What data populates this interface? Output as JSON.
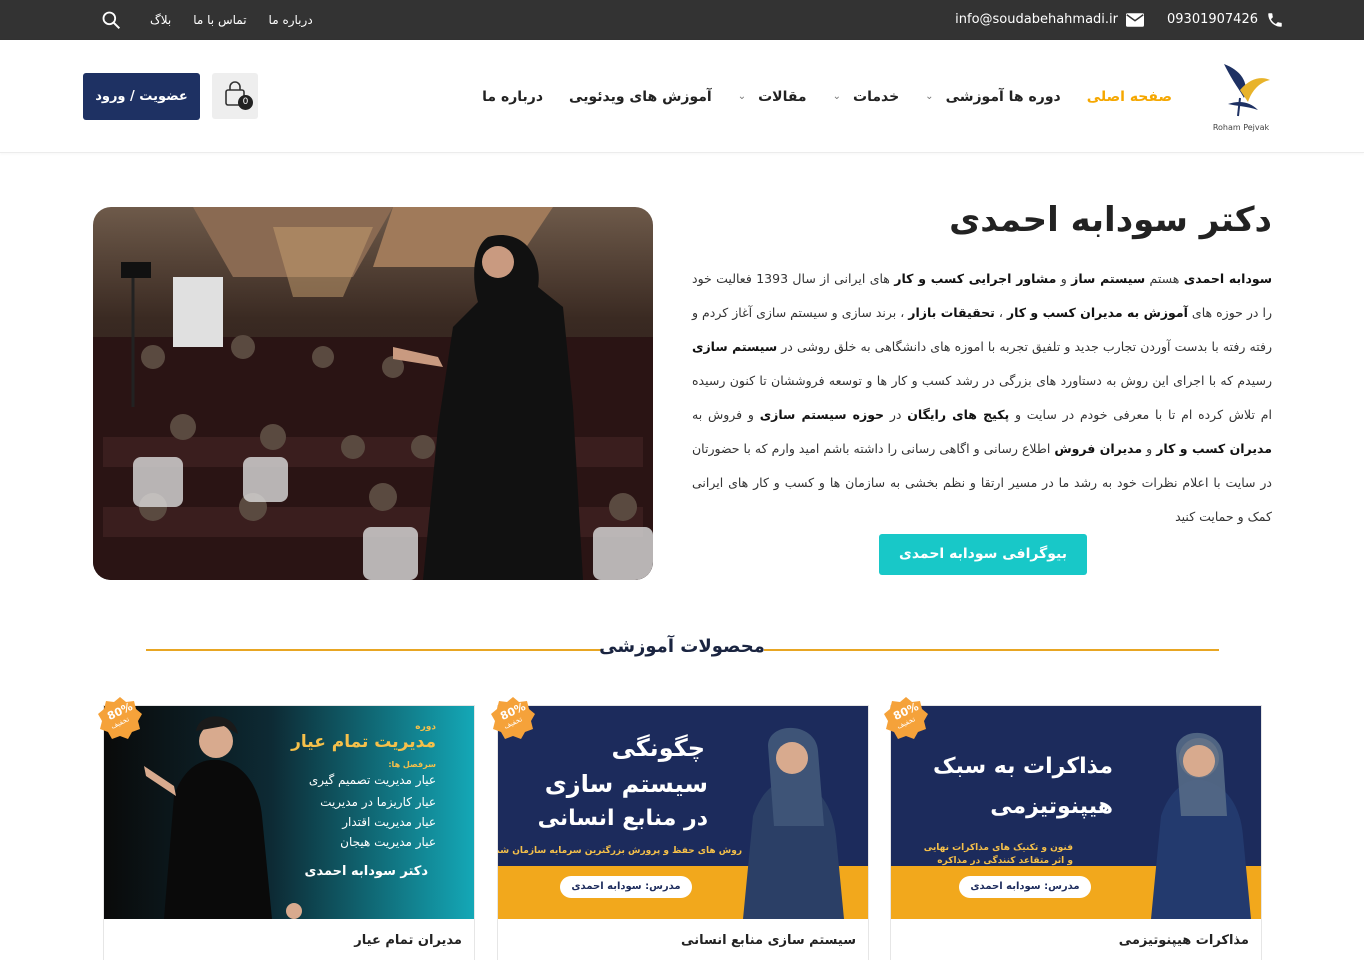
{
  "topbar": {
    "phone": "09301907426",
    "email": "info@soudabehahmadi.ir",
    "links": [
      "بلاگ",
      "تماس با ما",
      "درباره ما"
    ]
  },
  "header": {
    "logo_text": "Roham Pejvak",
    "nav": [
      {
        "label": "صفحه اصلی",
        "active": true,
        "dropdown": false
      },
      {
        "label": "دوره ها آموزشی",
        "active": false,
        "dropdown": true
      },
      {
        "label": "خدمات",
        "active": false,
        "dropdown": true
      },
      {
        "label": "مقالات",
        "active": false,
        "dropdown": true
      },
      {
        "label": "آموزش های ویدئویی",
        "active": false,
        "dropdown": false
      },
      {
        "label": "درباره ما",
        "active": false,
        "dropdown": false
      }
    ],
    "cart_count": "0",
    "login_label": "عضویت / ورود"
  },
  "hero": {
    "title": "دکتر سودابه احمدی",
    "paragraph": [
      {
        "b": true,
        "t": "سودابه احمدی"
      },
      {
        "b": false,
        "t": " هستم "
      },
      {
        "b": true,
        "t": "سیستم ساز"
      },
      {
        "b": false,
        "t": " و "
      },
      {
        "b": true,
        "t": "مشاور اجرایی کسب و کار"
      },
      {
        "b": false,
        "t": " های ایرانی از سال 1393 فعالیت خود را در حوزه های "
      },
      {
        "b": true,
        "t": "آموزش به مدیران کسب و کار"
      },
      {
        "b": false,
        "t": " ، "
      },
      {
        "b": true,
        "t": "تحقیقات بازار"
      },
      {
        "b": false,
        "t": " ، برند سازی و سیستم سازی آغاز کردم و رفته رفته با بدست آوردن تجارب جدید و تلفیق تجربه با اموزه های دانشگاهی به خلق روشی در "
      },
      {
        "b": true,
        "t": "سیستم سازی"
      },
      {
        "b": false,
        "t": " رسیدم که با اجرای این روش به دستاورد های بزرگی در رشد کسب و کار ها و توسعه فروششان تا کنون رسیده ام تلاش کرده ام تا با معرفی خودم در سایت و "
      },
      {
        "b": true,
        "t": "پکیج های رایگان"
      },
      {
        "b": false,
        "t": " در "
      },
      {
        "b": true,
        "t": "حوزه سیستم سازی"
      },
      {
        "b": false,
        "t": " و فروش به "
      },
      {
        "b": true,
        "t": "مدیران کسب و کار"
      },
      {
        "b": false,
        "t": " و "
      },
      {
        "b": true,
        "t": "مدیران فروش"
      },
      {
        "b": false,
        "t": " اطلاع رسانی و اگاهی رسانی را داشته باشم امید وارم که با حضورتان در سایت با اعلام نظرات خود به رشد ما در مسیر ارتقا و نظم بخشی به سازمان ها و کسب و کار های ایرانی کمک و حمایت کنید"
      }
    ],
    "bio_button": "بیوگرافی سودابه احمدی"
  },
  "products": {
    "section_title": "محصولات آموزشی",
    "items": [
      {
        "name": "مذاکرات هیپنوتیزمی",
        "discount": "80%",
        "discount_sub": "تخفیف",
        "banner_title_1": "مذاکرات به سبک",
        "banner_title_2": "هیپنوتیزمی",
        "banner_sub_1": "فنون و تکنیک های مذاکرات نهایی",
        "banner_sub_2": "و اثر متقاعد کنندگی در مذاکره",
        "teacher": "مدرس: سودابه احمدی"
      },
      {
        "name": "سیستم سازی منابع انسانی",
        "discount": "80%",
        "discount_sub": "تخفیف",
        "banner_title_1": "چگونگی",
        "banner_title_2": "سیستم سازی",
        "banner_title_3": "در منابع انسانی",
        "banner_sub_1": "روش های حفظ و پرورش بزرگترین سرمایه سازمان شما",
        "teacher": "مدرس: سودابه احمدی"
      },
      {
        "name": "مدیران تمام عیار",
        "discount": "80%",
        "discount_sub": "تخفیف",
        "banner_kicker": "دوره",
        "banner_title_1": "مدیریت تمام عیار",
        "banner_sub_head": "سرفصل ها:",
        "banner_list": [
          "عیار مدیریت تصمیم گیری",
          "عیار کاریزما در مدیریت",
          "عیار مدیریت اقتدار",
          "عیار مدیریت هیجان"
        ],
        "teacher": "دکتر سودابه احمدی"
      }
    ]
  }
}
